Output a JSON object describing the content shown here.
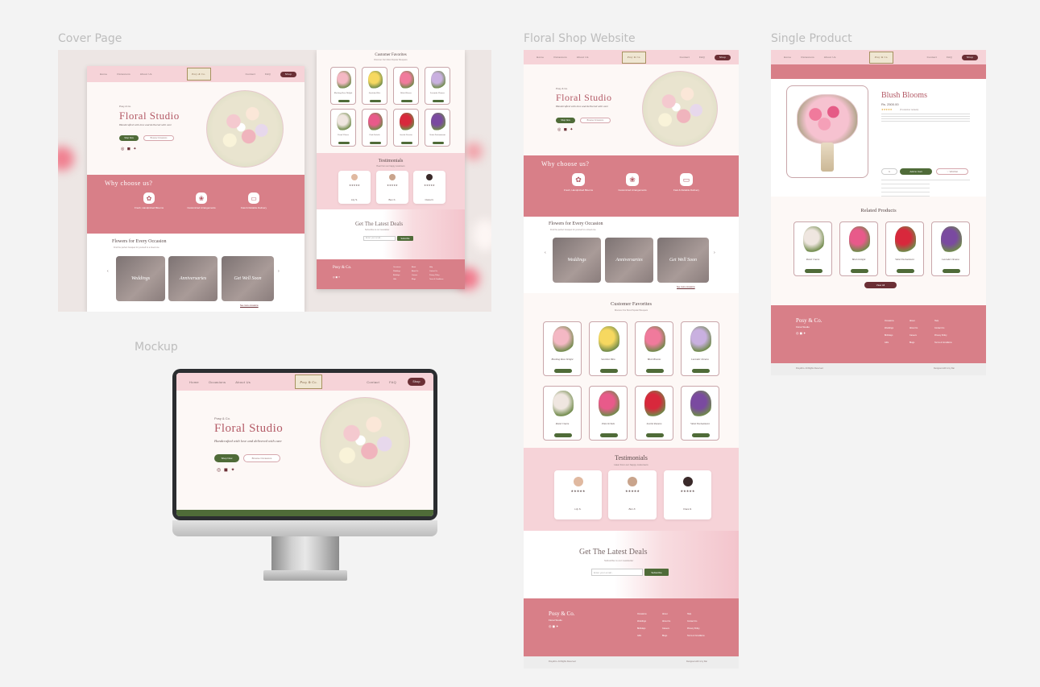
{
  "labels": {
    "cover": "Cover Page",
    "mockup": "Mockup",
    "website": "Floral Shop Website",
    "single": "Single Product"
  },
  "nav": {
    "home": "Home",
    "occasions": "Occasions",
    "about": "About Us",
    "contact": "Contact",
    "faq": "FAQ",
    "shop": "Shop",
    "logo": "Posy & Co."
  },
  "hero": {
    "brand": "Posy & Co.",
    "title": "Floral Studio",
    "tagline": "Handcrafted with love and delivered with care",
    "shop_now": "Shop Now",
    "browse": "Browse Occasions"
  },
  "why": {
    "title": "Why choose us?",
    "items": [
      {
        "title": "Fresh, Handpicked Blooms",
        "icon": "flower-icon"
      },
      {
        "title": "Customized Arrangements",
        "icon": "gift-icon"
      },
      {
        "title": "Fast & Reliable Delivery",
        "icon": "truck-icon"
      }
    ]
  },
  "occasions": {
    "title": "Flowers for Every Occasion",
    "subtitle": "Find the perfect bouquet for yourself or a loved one",
    "items": [
      "Weddings",
      "Anniversaries",
      "Get Well Soon"
    ],
    "more": "See more occasions"
  },
  "favorites": {
    "title": "Customer Favorites",
    "subtitle": "Discover Our Most Popular Bouquets",
    "items": [
      "Blushing Rose Delight",
      "Sunshine Bliss",
      "Blush Blooms",
      "Lavender Dreams",
      "Pastel Charm",
      "Pink Orchids",
      "Scarlet Passion",
      "Violet Enchantment"
    ],
    "button": "Add to Cart"
  },
  "testimonials": {
    "title": "Testimonials",
    "subtitle": "Hear from our happy customers",
    "stars": "★★★★★",
    "names": [
      "Lily S.",
      "Ben K.",
      "Clara D."
    ]
  },
  "deals": {
    "title": "Get The Latest Deals",
    "subtitle": "Subscribe to our newsletter",
    "placeholder": "Enter your email...",
    "button": "Subscribe"
  },
  "footer": {
    "brand": "Posy & Co.",
    "tagline": "Floral Studio",
    "col1": [
      "Occasions",
      "Weddings",
      "Birthdays",
      "Gifts"
    ],
    "col2": [
      "About",
      "About Us",
      "Careers",
      "Blogs"
    ],
    "col3": [
      "Help",
      "Contact Us",
      "Privacy Policy",
      "Terms & Conditions"
    ],
    "copyright": "Posy&Co. All Rights Reserved",
    "designed": "Designed with ♥ by Rai"
  },
  "product": {
    "name": "Blush Blooms",
    "price": "Rs. 2500.00",
    "stars": "★★★★★",
    "reviews": "(5 customer reviews)",
    "qty": "1",
    "add": "Add to Cart",
    "wishlist": "♡ Wishlist",
    "related": "Related Products",
    "related_items": [
      "Pastel Charm",
      "Blush Delight",
      "Violet Enchantment",
      "Lavender Dreams"
    ],
    "view_all": "View All"
  }
}
